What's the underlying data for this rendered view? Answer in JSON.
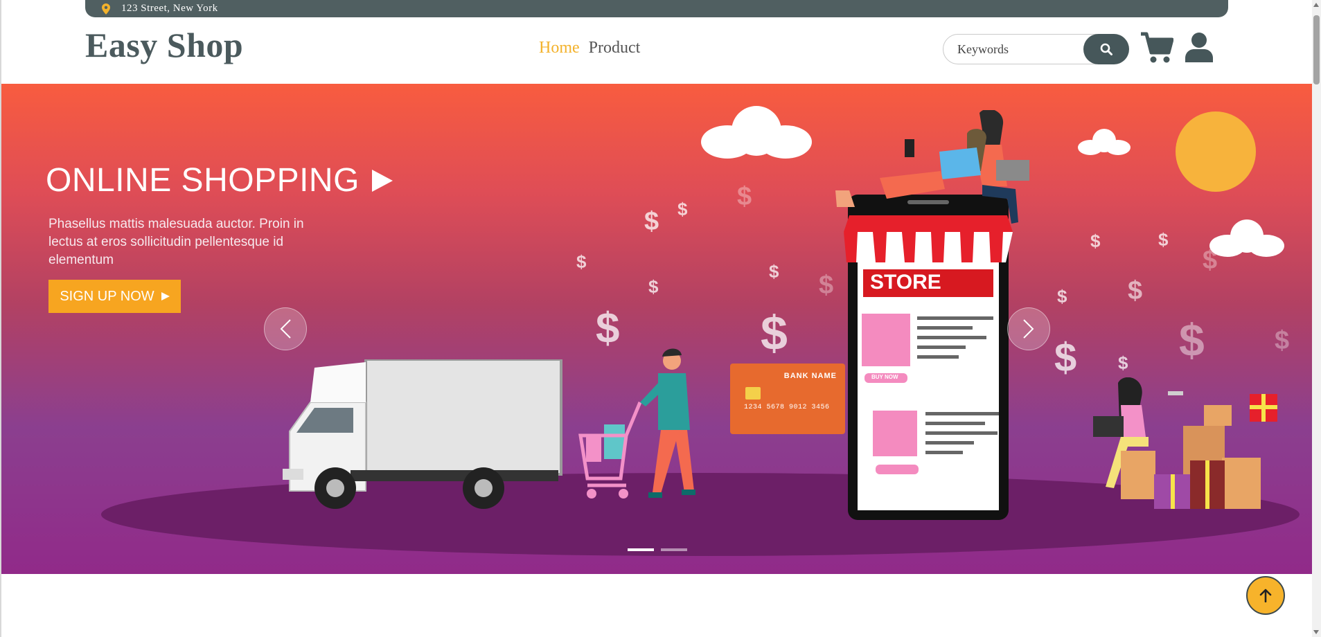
{
  "topbar": {
    "address": "123 Street, New York",
    "icon": "map-pin-icon"
  },
  "header": {
    "brand": "Easy Shop",
    "nav": [
      {
        "label": "Home",
        "active": true
      },
      {
        "label": "Product",
        "active": false
      }
    ],
    "search": {
      "placeholder": "Keywords",
      "value": "",
      "button_icon": "search-icon"
    },
    "icons": [
      "cart-icon",
      "user-icon"
    ]
  },
  "hero": {
    "title": "ONLINE SHOPPING",
    "subtitle": "Phasellus mattis malesuada auctor. Proin in lectus at eros sollicitudin pellentesque id elementum",
    "cta_label": "SIGN UP NOW",
    "store_label": "STORE",
    "buy_now_label": "BUY NOW",
    "card": {
      "bank": "BANK NAME",
      "number": "1234 5678 9012 3456"
    },
    "slides": {
      "total": 2,
      "active_index": 0
    },
    "controls": [
      "chevron-left-icon",
      "chevron-right-icon"
    ]
  },
  "scroll_top": {
    "icon": "arrow-up-icon"
  },
  "colors": {
    "accent": "#f3b22c",
    "dark": "#46575a",
    "cta": "#f7a520",
    "hero_top": "#f85c3f",
    "hero_bottom": "#912a89"
  }
}
